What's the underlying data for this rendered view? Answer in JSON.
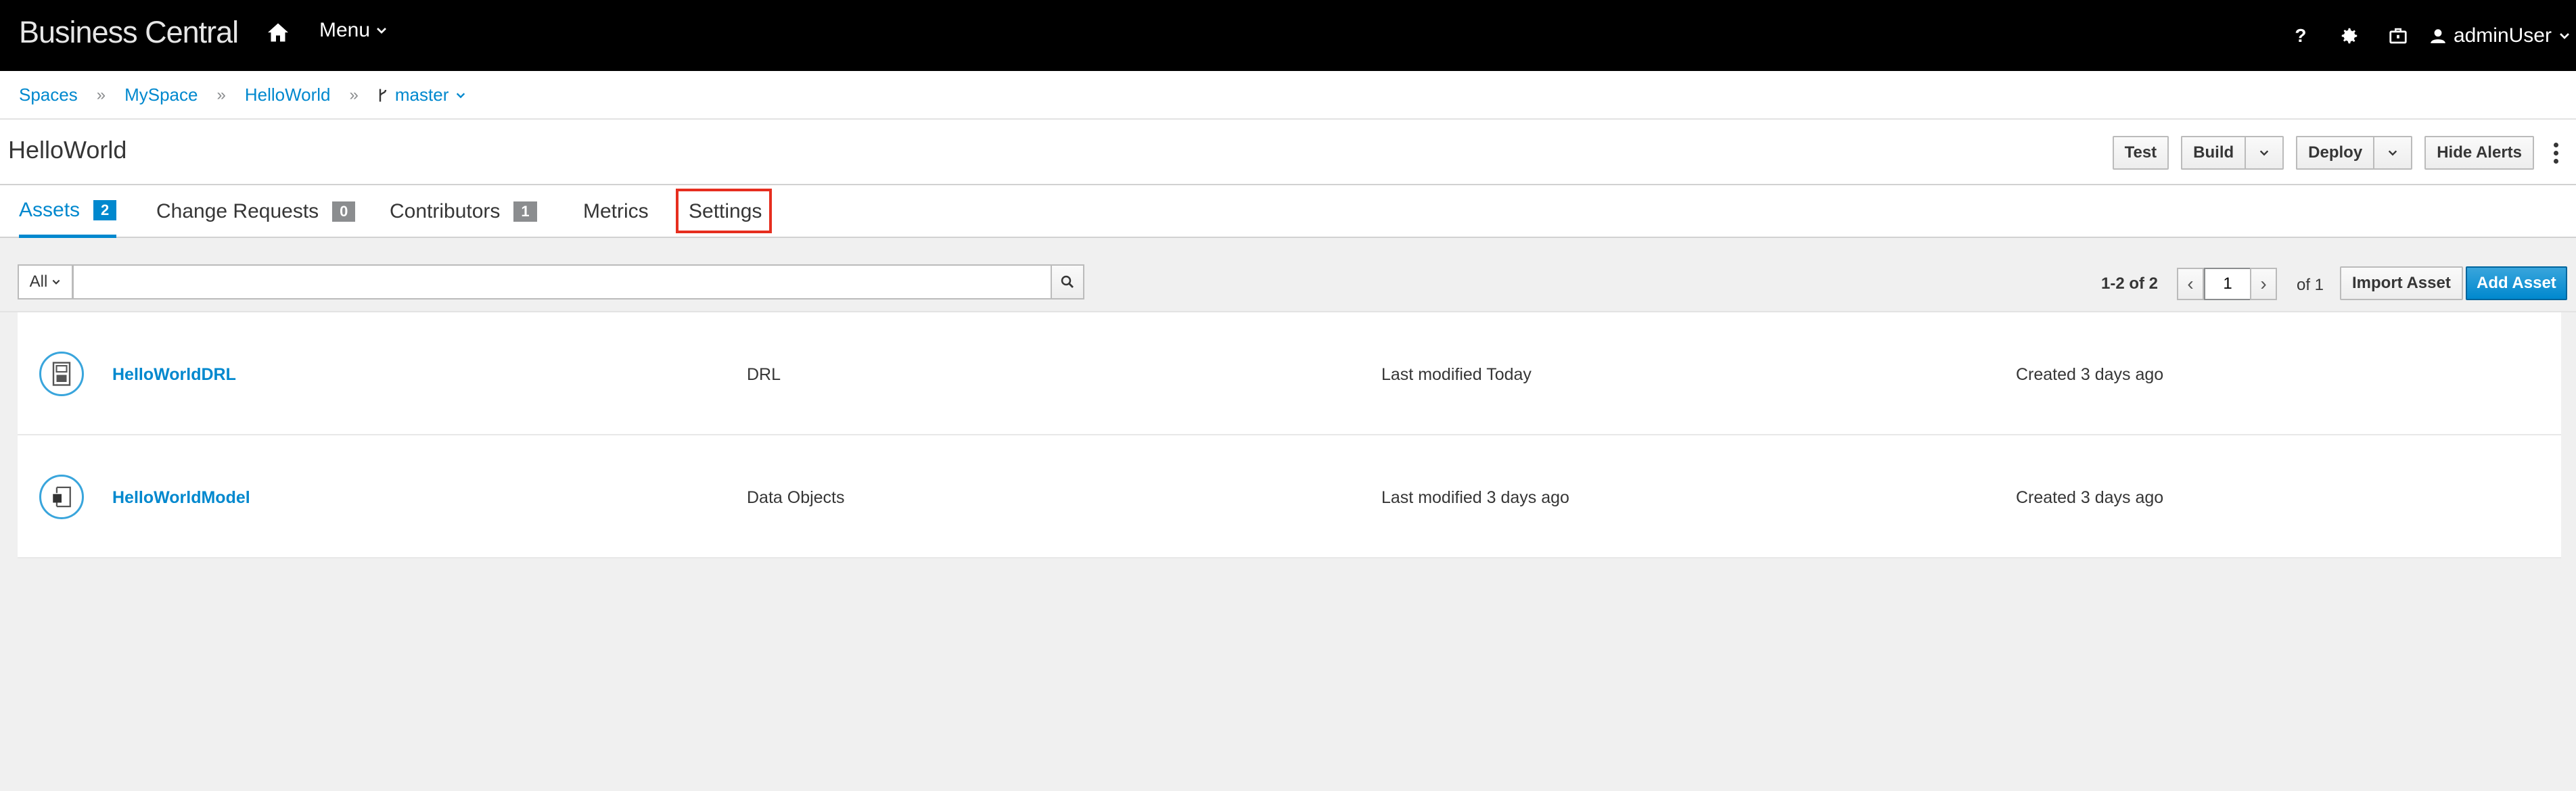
{
  "app": {
    "brand": "Business Central"
  },
  "navbar": {
    "menu_label": "Menu",
    "user_label": "adminUser",
    "icons": [
      "home-icon",
      "help-icon",
      "gear-icon",
      "briefcase-icon",
      "user-icon"
    ]
  },
  "breadcrumb": {
    "items": [
      {
        "label": "Spaces"
      },
      {
        "label": "MySpace"
      },
      {
        "label": "HelloWorld"
      }
    ],
    "branch": "master"
  },
  "title_bar": {
    "title": "HelloWorld",
    "buttons": {
      "test": "Test",
      "build": "Build",
      "deploy": "Deploy",
      "hide_alerts": "Hide Alerts"
    }
  },
  "tabs": [
    {
      "label": "Assets",
      "badge": "2"
    },
    {
      "label": "Change Requests",
      "badge": "0"
    },
    {
      "label": "Contributors",
      "badge": "1"
    },
    {
      "label": "Metrics"
    },
    {
      "label": "Settings"
    }
  ],
  "filter": {
    "select_value": "All",
    "search_value": "",
    "range_text": "1-2 of 2",
    "page_value": "1",
    "of_text": "of 1",
    "import_label": "Import Asset",
    "add_label": "Add Asset"
  },
  "assets": [
    {
      "name": "HelloWorldDRL",
      "type": "DRL",
      "modified": "Last modified Today",
      "created": "Created 3 days ago",
      "icon": "drl-file-icon"
    },
    {
      "name": "HelloWorldModel",
      "type": "Data Objects",
      "modified": "Last modified 3 days ago",
      "created": "Created 3 days ago",
      "icon": "data-object-icon"
    }
  ],
  "colors": {
    "accent": "#0088ce",
    "highlight": "#e62e1f",
    "navbar": "#000000"
  }
}
